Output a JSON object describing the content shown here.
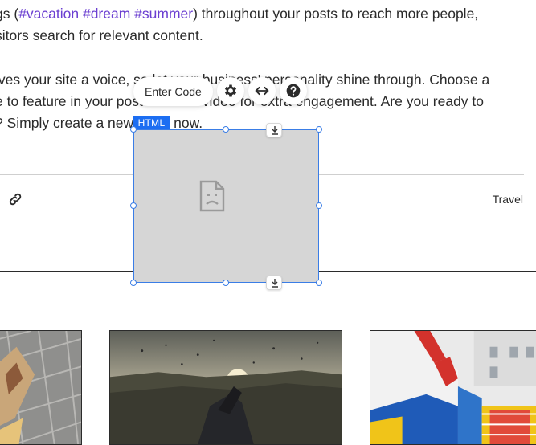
{
  "post": {
    "p1_line1_start": "gs (",
    "p1_tags": "#vacation #dream #summer",
    "p1_line1_end": ") throughout your posts to reach more people,",
    "p1_line2": "sitors search for relevant content.",
    "p2_line1": "ives your site a voice, so let your business' personality shine through. Choose a",
    "p2_line2": "e to feature in your post or add a video for extra engagement. Are you ready to",
    "p2_line3_start": "? Simply create a new",
    "p2_line3_end": "now."
  },
  "meta": {
    "category": "Travel"
  },
  "html_element": {
    "badge": "HTML",
    "enter_code_label": "Enter Code"
  },
  "icons": {
    "link": "link-icon",
    "settings": "gear-icon",
    "stretch": "stretch-arrows-icon",
    "help": "help-icon",
    "broken": "broken-document-icon",
    "anchor": "download-anchor-icon"
  },
  "colors": {
    "accent": "#1c6ef2",
    "selection": "#3a7de6",
    "hashtag": "#6b3fd1",
    "placeholder_bg": "#d6d6d6"
  }
}
